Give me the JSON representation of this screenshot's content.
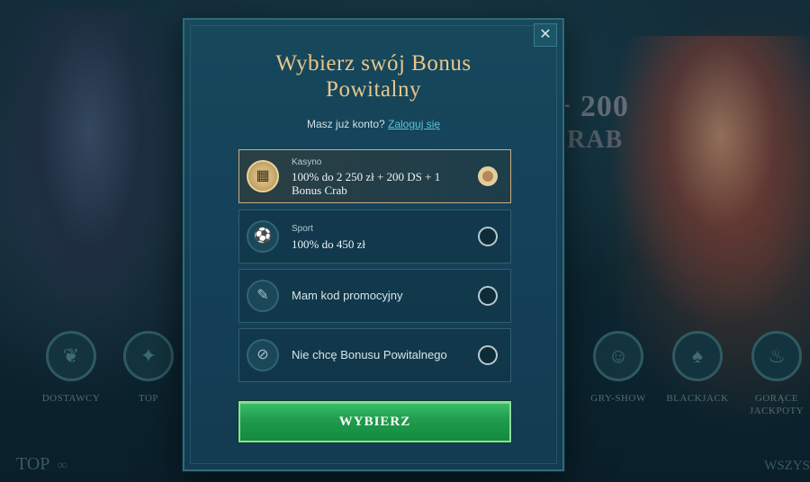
{
  "background": {
    "headline_1": "+ 200",
    "headline_2": "RAB",
    "categories_left": [
      {
        "label": "DOSTAWCY",
        "icon": "providers-icon"
      },
      {
        "label": "TOP",
        "icon": "top-icon"
      }
    ],
    "categories_right": [
      {
        "label": "GRY-SHOW",
        "icon": "mask-icon"
      },
      {
        "label": "BLACKJACK",
        "icon": "cards-icon"
      },
      {
        "label": "GORĄCE JACKPOTY",
        "icon": "flame-icon"
      }
    ],
    "section_top": "TOP",
    "section_all": "WSZYS"
  },
  "modal": {
    "close_label": "✕",
    "title": "Wybierz swój Bonus Powitalny",
    "login_prompt": "Masz już konto?",
    "login_link": "Zaloguj się",
    "options": [
      {
        "category": "Kasyno",
        "label": "100% do 2 250 zł + 200 DS + 1 Bonus Crab",
        "icon": "slot-machine-icon",
        "selected": true
      },
      {
        "category": "Sport",
        "label": "100% do 450 zł",
        "icon": "soccer-ball-icon",
        "selected": false
      },
      {
        "category": "",
        "label": "Mam kod promocyjny",
        "icon": "ticket-icon",
        "selected": false
      },
      {
        "category": "",
        "label": "Nie chcę Bonusu Powitalnego",
        "icon": "no-bonus-icon",
        "selected": false
      }
    ],
    "submit_label": "WYBIERZ"
  },
  "colors": {
    "title_gold": "#e9c68a",
    "link_cyan": "#5ec3d6",
    "button_green": "#1f9c4c",
    "modal_bg": "#15425a"
  }
}
